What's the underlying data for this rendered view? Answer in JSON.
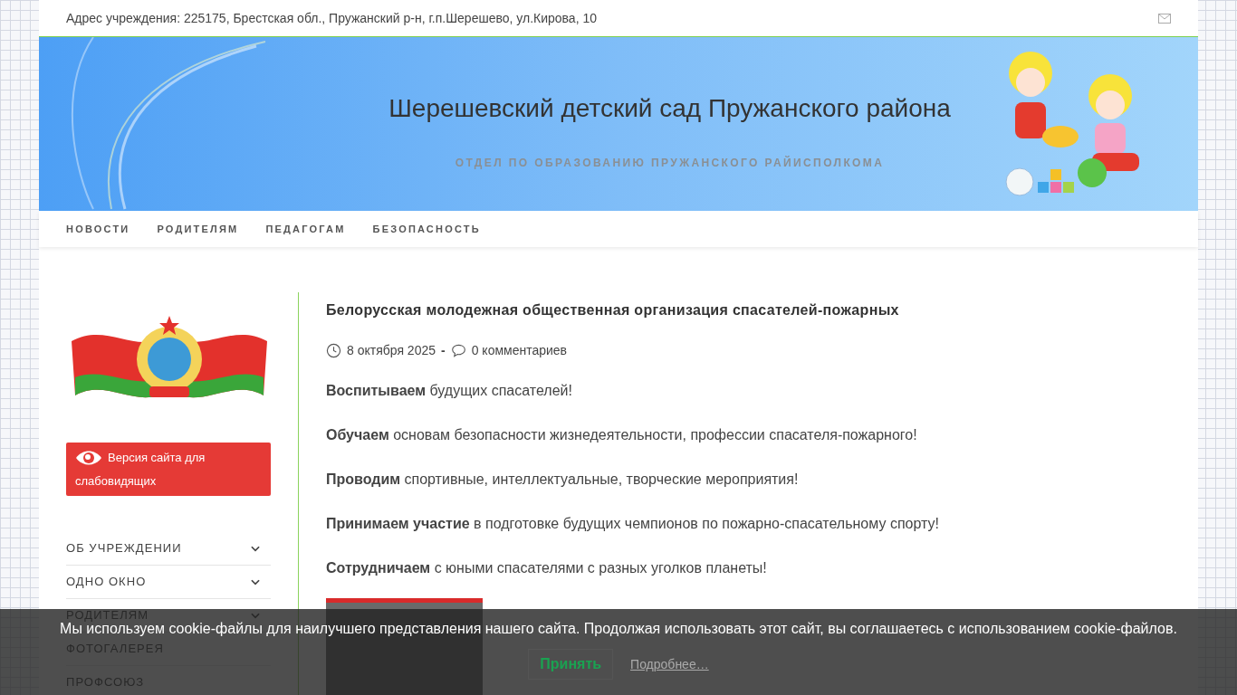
{
  "top_bar": {
    "address": "Адрес учреждения: 225175, Брестская обл., Пружанский р-н, г.п.Шерешево, ул.Кирова, 10"
  },
  "header": {
    "title": "Шерешевский детский сад Пружанского района",
    "subtitle": "ОТДЕЛ ПО ОБРАЗОВАНИЮ ПРУЖАНСКОГО РАЙИСПОЛКОМА"
  },
  "nav": [
    "НОВОСТИ",
    "РОДИТЕЛЯМ",
    "ПЕДАГОГАМ",
    "БЕЗОПАСНОСТЬ"
  ],
  "sidebar": {
    "accessibility_button": "Версия сайта для слабовидящих",
    "menu": [
      {
        "label": "ОБ УЧРЕЖДЕНИИ",
        "kind": "submenu"
      },
      {
        "label": "ОДНО ОКНО",
        "kind": "submenu"
      },
      {
        "label": "РОДИТЕЛЯМ",
        "kind": "submenu"
      },
      {
        "label": "ФОТОГАЛЕРЕЯ",
        "kind": "link"
      },
      {
        "label": "ПРОФСОЮЗ",
        "kind": "link"
      }
    ]
  },
  "article": {
    "title": "Белорусская молодежная общественная организация спасателей-пожарных",
    "date": "8 октября 2025",
    "separator": "-",
    "comments": "0 комментариев",
    "paragraphs": [
      "**Воспитываем** будущих спасателей!",
      "**Обучаем** основам безопасности жизнедеятельности, профессии спасателя-пожарного!",
      "**Проводим** спортивные, интеллектуальные, творческие мероприятия!",
      "**Принимаем участие** в подготовке будущих чемпионов по пожарно-спасательному спорту!",
      "**Сотрудничаем** с юными спасателями с разных уголков планеты!"
    ]
  },
  "cookie_bar": {
    "message": "Мы используем cookie-файлы для наилучшего представления нашего сайта. Продолжая использовать этот сайт, вы соглашаетесь с использованием cookie-файлов.",
    "accept": "Принять",
    "more": "Подробнее…"
  }
}
